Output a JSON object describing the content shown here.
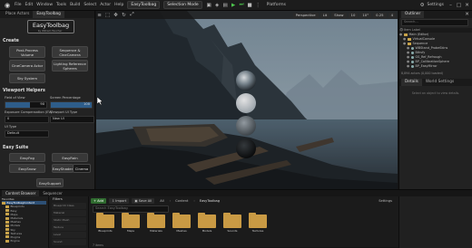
{
  "titlebar": {
    "menu": [
      "File",
      "Edit",
      "Window",
      "Tools",
      "Build",
      "Select",
      "Actor",
      "Help"
    ],
    "project_tab": "EasyToolbag",
    "mode": "Selection Mode",
    "platforms": "Platforms",
    "settings": "Settings"
  },
  "left_panel": {
    "tabs": [
      "Place Actors",
      "EasyToolbag"
    ],
    "header_title": "EasyToolbag",
    "header_subtitle": "by William Faucher",
    "create": {
      "title": "Create",
      "buttons": [
        "Post-Process Volume",
        "Sequence & CineCamera",
        "CineCamera Actor",
        "Lighting Reference Spheres",
        "Sky System"
      ]
    },
    "viewport_helpers": {
      "title": "Viewport Helpers",
      "fov_label": "Field of View",
      "fov_value": "90",
      "focal_label": "Screen Percentage",
      "focal_value": "100",
      "exposure_label": "Exposure Compensation (EV)",
      "exposure_value": "0",
      "viewport_type_label": "Viewport UI Type",
      "viewport_type_value": "New UI",
      "ui_type_label": "UI Type",
      "ui_type_value": "Default"
    },
    "easy_suite": {
      "title": "Easy Suite",
      "buttons": [
        "EasyFog",
        "EasyRain",
        "EasySnow",
        "EasyShader",
        "Cinema"
      ],
      "support": "EasySupport"
    }
  },
  "viewport": {
    "perspective": "Perspective",
    "lit": "Lit",
    "show": "Show",
    "grid": "10",
    "angle": "10°",
    "scale": "0.25",
    "speed": "4"
  },
  "outliner": {
    "tabs": [
      "Outliner"
    ],
    "search_placeholder": "Search...",
    "items": [
      {
        "label": "Item Label",
        "type": "header"
      },
      {
        "label": "Main (Editor)",
        "type": "folder"
      },
      {
        "label": "VirtualConsole",
        "type": "folder"
      },
      {
        "label": "Sequence",
        "type": "folder"
      },
      {
        "label": "WBStand_ProbeSkins",
        "type": "actor"
      },
      {
        "label": "Bthsfy",
        "type": "actor"
      },
      {
        "label": "GS_Ref_Refrough",
        "type": "actor"
      },
      {
        "label": "BP_CallibrationSphere",
        "type": "actor"
      },
      {
        "label": "BP_EasyMirror",
        "type": "actor"
      }
    ],
    "count": "8,894 actors (0,000 loaded)",
    "details_tabs": [
      "Details",
      "World Settings"
    ],
    "details_hint": "Select an object to view details."
  },
  "bottom": {
    "tabs": [
      "Content Browser",
      "Sequencer"
    ],
    "toolbar": {
      "add": "Add",
      "import": "Import",
      "save_all": "Save All",
      "path": [
        "All",
        "Content",
        "EasyToolbag"
      ],
      "settings": "Settings"
    },
    "tree_header": "Favorites",
    "tree_root": "EasyToolbagContent",
    "tree_items": [
      "Blueprints",
      "Easy",
      "Maps",
      "Materials",
      "Meshes",
      "Models",
      "Sky",
      "Textures",
      "Plugins",
      "Engine"
    ],
    "filter_header": "Filters",
    "filters": [
      "Blueprint Class",
      "Material",
      "Static Mesh",
      "Texture",
      "Level",
      "Sound"
    ],
    "search_placeholder": "Search EasyToolbag",
    "assets": [
      "Blueprints",
      "Maps",
      "Materials",
      "Meshes",
      "Models",
      "Sounds",
      "Textures"
    ],
    "status": "7 items"
  }
}
